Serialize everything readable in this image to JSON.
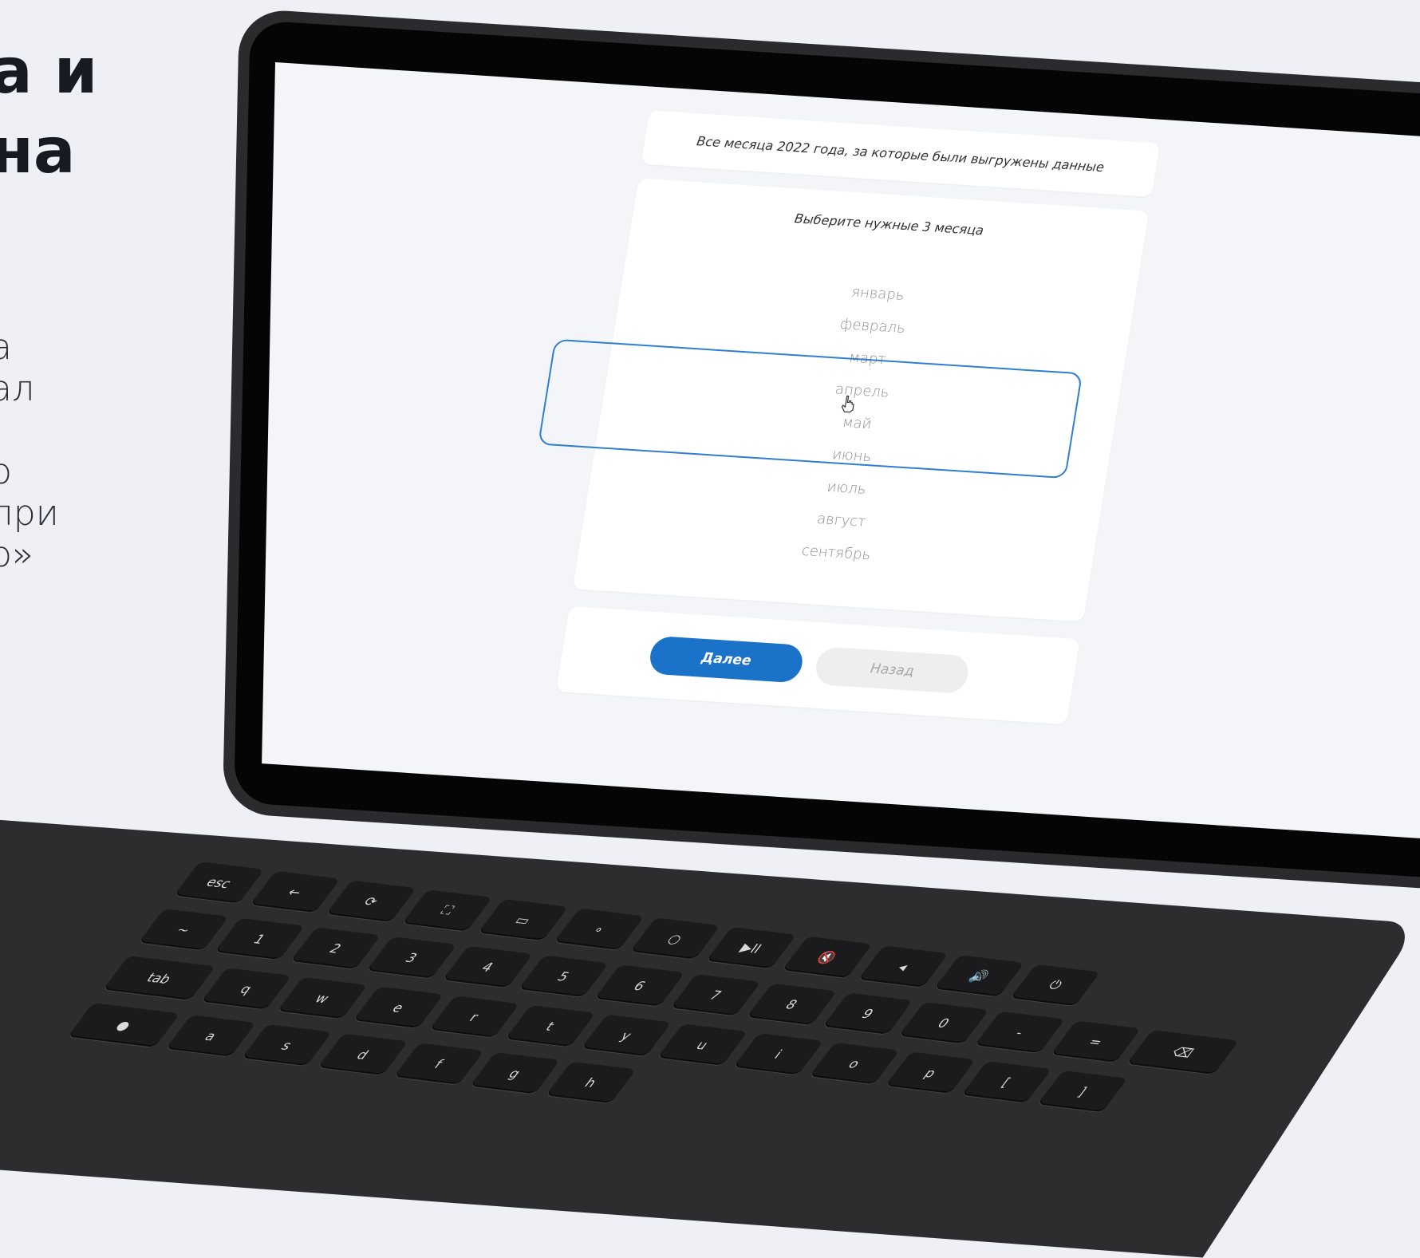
{
  "promo": {
    "title_lines": "а и\nна",
    "body_lines": "а\nал\n\nо\nпри\nо»"
  },
  "screen": {
    "header": "Все месяца 2022 года, за которые были выгружены данные",
    "picker": {
      "title": "Выберите нужные 3 месяца",
      "months": [
        "январь",
        "февраль",
        "март",
        "апрель",
        "май",
        "июнь",
        "июль",
        "август",
        "сентябрь"
      ],
      "selected": [
        "апрель",
        "май",
        "июнь"
      ]
    },
    "buttons": {
      "next": "Далее",
      "back": "Назад"
    },
    "colors": {
      "accent": "#1a73c8",
      "selection_border": "#2f7fce",
      "month_text": "#8d9096"
    }
  },
  "keyboard": {
    "row1": [
      "esc",
      "←",
      "⟳",
      "⛶",
      "▭",
      "∘",
      "○",
      "▶II",
      "🔇",
      "◂",
      "🔊",
      "⏻"
    ],
    "row2": [
      "~",
      "1",
      "2",
      "3",
      "4",
      "5",
      "6",
      "7",
      "8",
      "9",
      "0",
      "-",
      "=",
      "⌫"
    ],
    "row3": [
      "tab",
      "q",
      "w",
      "e",
      "r",
      "t",
      "y",
      "u",
      "i",
      "o",
      "p",
      "[",
      "]"
    ],
    "row4": [
      "●",
      "a",
      "s",
      "d",
      "f",
      "g",
      "h"
    ]
  }
}
